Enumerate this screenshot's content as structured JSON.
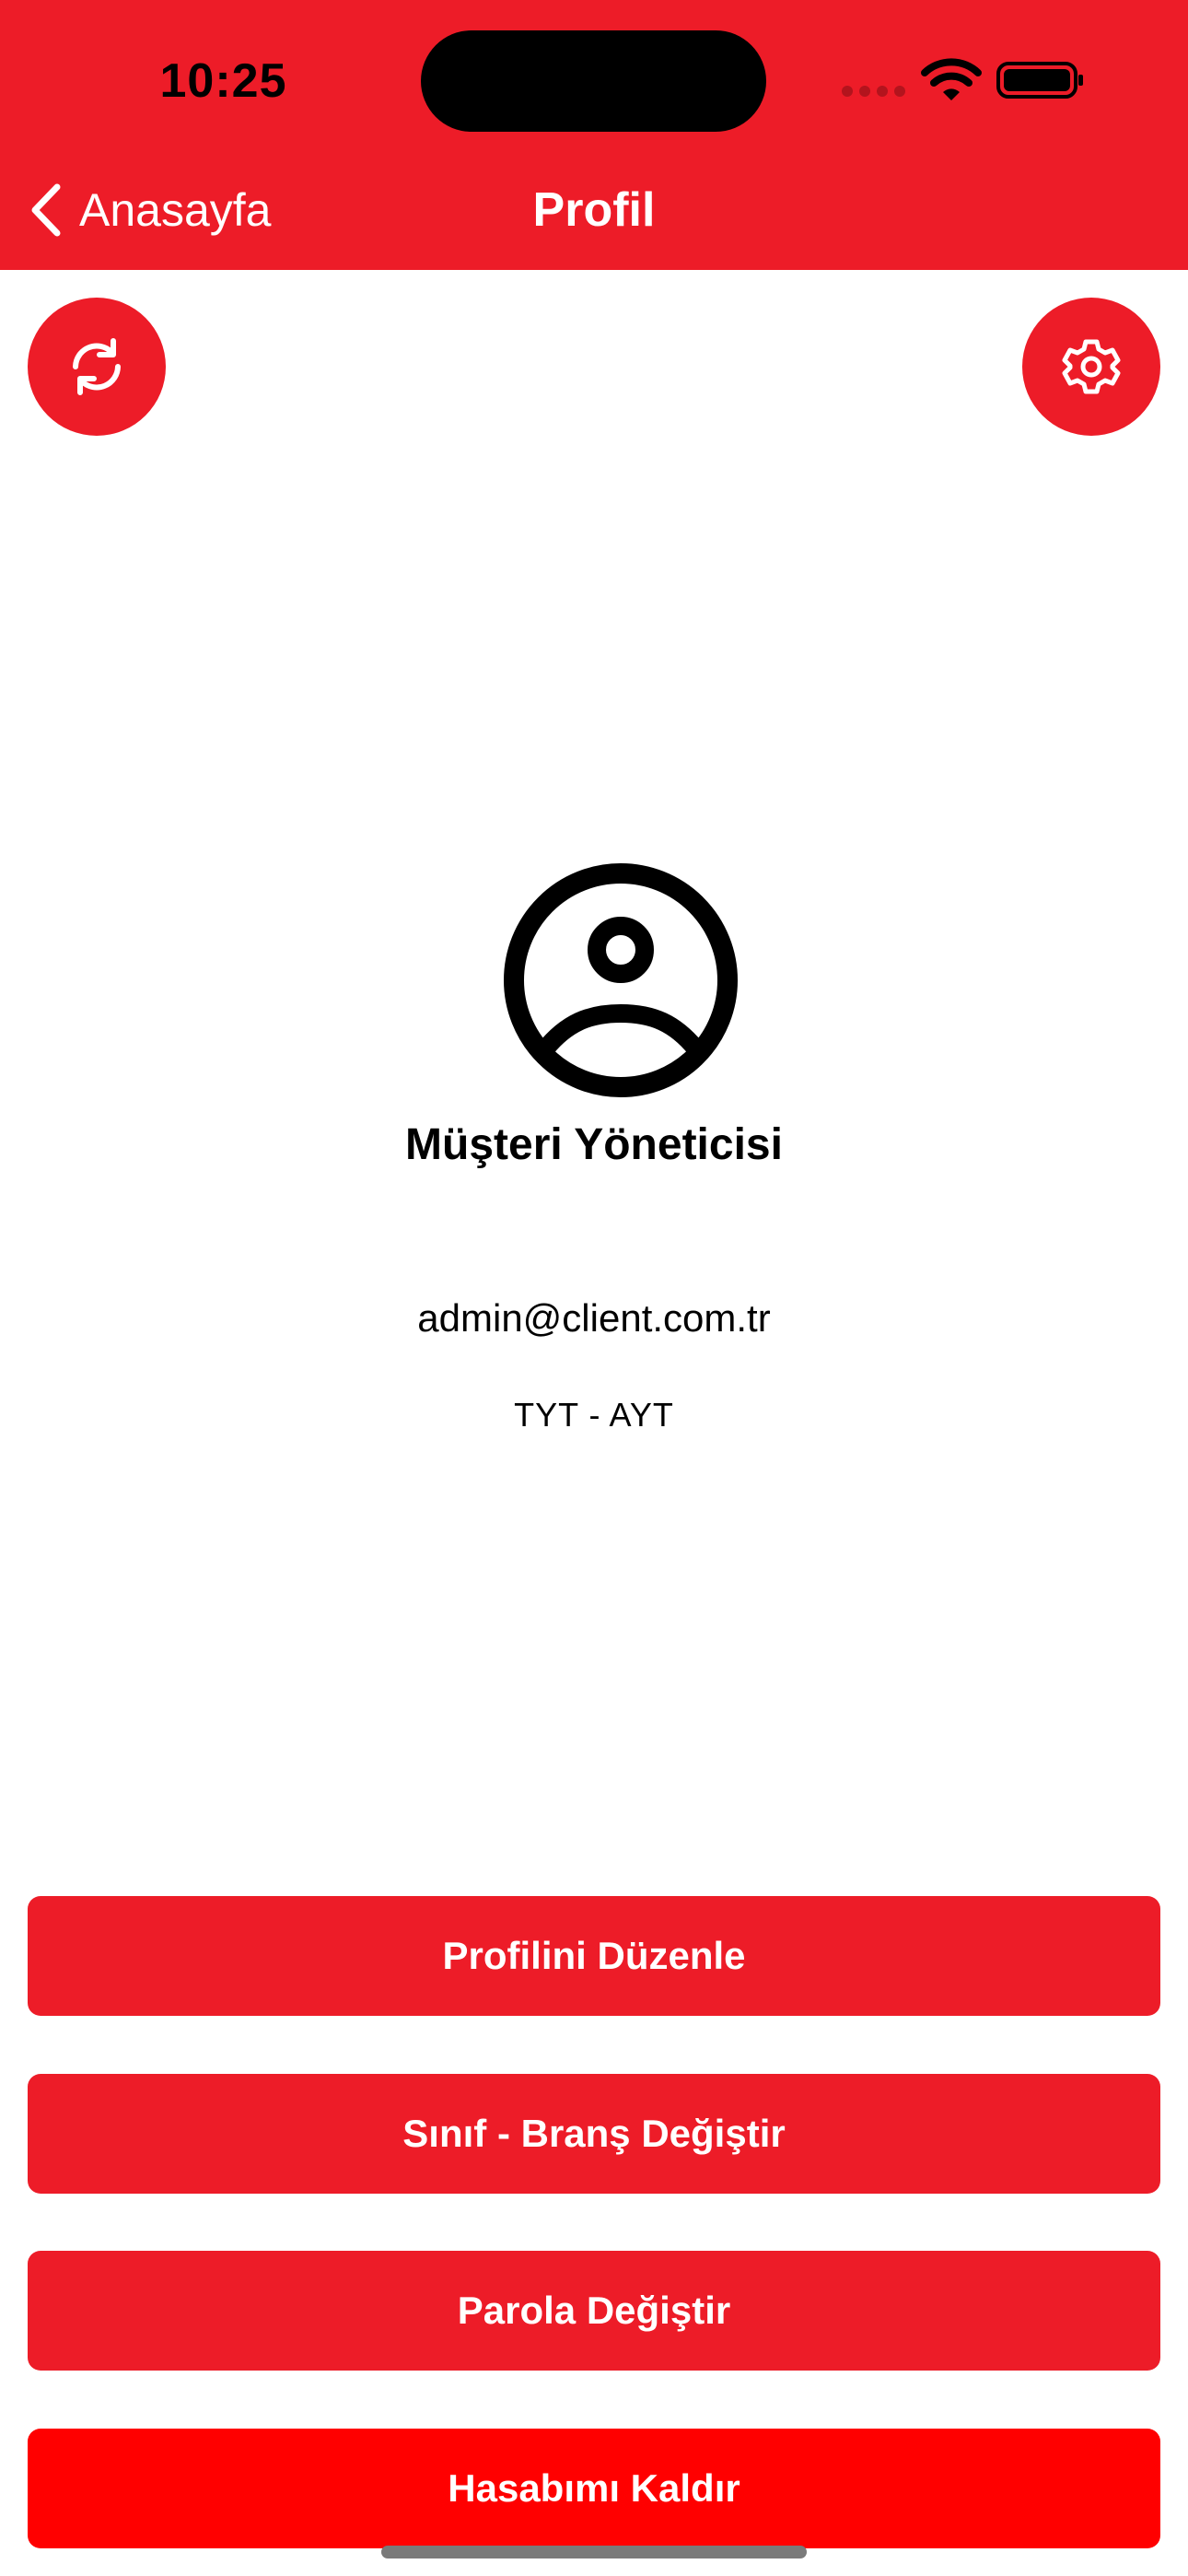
{
  "status_bar": {
    "time": "10:25"
  },
  "nav": {
    "back_label": "Anasayfa",
    "title": "Profil"
  },
  "icons": {
    "back": "chevron-left-icon",
    "refresh": "refresh-icon",
    "settings": "gear-icon",
    "avatar": "user-circle-icon",
    "wifi": "wifi-icon",
    "battery": "battery-icon",
    "cellular": "cellular-signal-icon"
  },
  "profile": {
    "name": "Müşteri Yöneticisi",
    "email": "admin@client.com.tr",
    "exam_type": "TYT - AYT"
  },
  "actions": {
    "edit_profile": "Profilini Düzenle",
    "change_class": "Sınıf - Branş Değiştir",
    "change_password": "Parola Değiştir",
    "delete_account": "Hasabımı Kaldır"
  },
  "colors": {
    "brand_red": "#ED1C28",
    "danger_red": "#FF0000",
    "text": "#000000",
    "on_brand": "#FFFFFF"
  }
}
